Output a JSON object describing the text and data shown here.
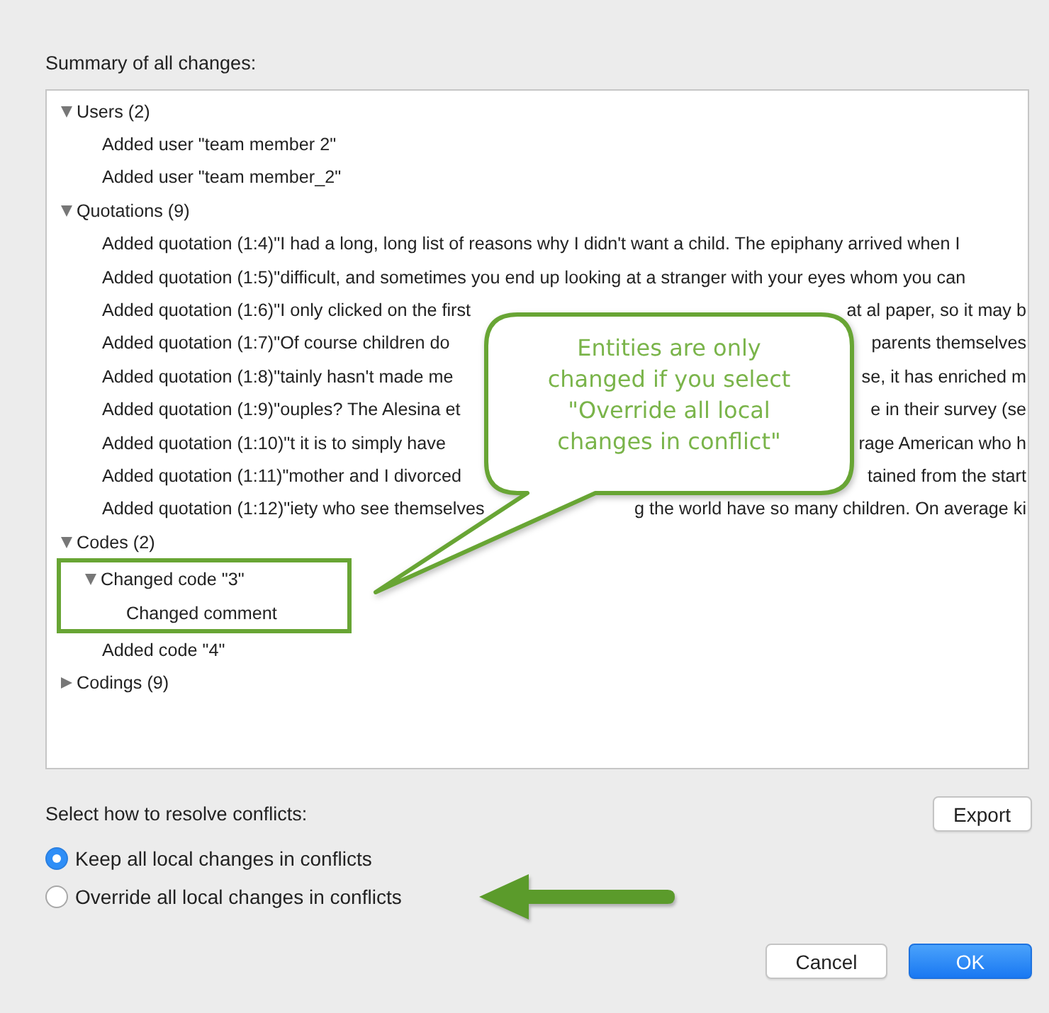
{
  "heading": "Summary of all changes:",
  "tree": [
    {
      "label": "Users (2)",
      "expanded": true,
      "children": [
        {
          "label": "Added user \"team member 2\""
        },
        {
          "label": "Added user \"team member_2\""
        }
      ]
    },
    {
      "label": "Quotations (9)",
      "expanded": true,
      "children": [
        {
          "label": "Added quotation (1:4)\"I had a long, long list of reasons why I didn't want a child. The epiphany arrived when I"
        },
        {
          "label": "Added quotation (1:5)\"difficult, and sometimes you end up looking at a stranger with your eyes whom you can"
        },
        {
          "label": "Added quotation (1:6)\"I only clicked on the first",
          "right_label": "at al paper, so it may b"
        },
        {
          "label": "Added quotation (1:7)\"Of course children do",
          "right_label": "parents themselves"
        },
        {
          "label": "Added quotation (1:8)\"tainly hasn't made me",
          "right_label": "se, it has enriched m"
        },
        {
          "label": "Added quotation (1:9)\"ouples? The Alesina et",
          "right_label": "e in their survey (se"
        },
        {
          "label": "Added quotation (1:10)\"t it is to simply have",
          "right_label": "rage American who h"
        },
        {
          "label": "Added quotation (1:11)\"mother and I divorced",
          "right_label": "tained from the start"
        },
        {
          "label": "Added quotation (1:12)\"iety who see themselves",
          "right_label": "g the world have so many children. On average ki"
        }
      ]
    },
    {
      "label": "Codes (2)",
      "expanded": true,
      "children": [
        {
          "label": "Changed code \"3\"",
          "expanded": true,
          "highlighted": true,
          "children": [
            {
              "label": "Changed comment"
            }
          ]
        },
        {
          "label": "Added code \"4\""
        }
      ]
    },
    {
      "label": "Codings (9)",
      "expanded": false
    }
  ],
  "callout": {
    "text": "Entities are only\nchanged if you select\n\"Override all local\nchanges in conflict\""
  },
  "resolve": {
    "label": "Select how to resolve conflicts:",
    "options": [
      {
        "label": "Keep all local changes in conflicts",
        "selected": true
      },
      {
        "label": "Override all local changes in conflicts",
        "selected": false
      }
    ]
  },
  "export_button": {
    "label": "Export"
  },
  "buttons": [
    {
      "label": "Cancel",
      "kind": "secondary"
    },
    {
      "label": "OK",
      "kind": "primary"
    }
  ]
}
